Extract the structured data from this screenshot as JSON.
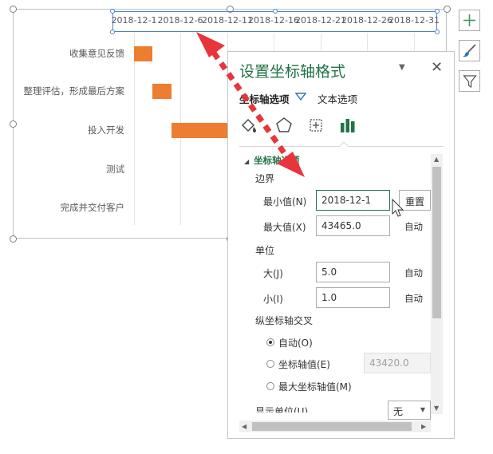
{
  "chart": {
    "date_ticks": [
      "2018-12-1",
      "2018-12-6",
      "2018-12-11",
      "2018-12-16",
      "2018-12-21",
      "2018-12-26",
      "2018-12-31"
    ],
    "tasks": [
      "收集意见反馈",
      "整理评估，形成最后方案",
      "投入开发",
      "测试",
      "完成并交付客户"
    ],
    "bar_color": "#ed7d31"
  },
  "tools": {
    "add_element_icon": "plus-icon",
    "style_icon": "brush-icon",
    "filter_icon": "funnel-icon"
  },
  "pane": {
    "title": "设置坐标轴格式",
    "tab_axis_options": "坐标轴选项",
    "tab_text_options": "文本选项",
    "section_axis_options": "坐标轴选项",
    "bounds": {
      "label": "边界",
      "min_label": "最小值(N)",
      "min_value": "2018-12-1",
      "reset_button": "重置",
      "max_label": "最大值(X)",
      "max_value": "43465.0",
      "max_auto": "自动"
    },
    "units": {
      "label": "单位",
      "major_label": "大(J)",
      "major_value": "5.0",
      "major_auto": "自动",
      "minor_label": "小(I)",
      "minor_value": "1.0",
      "minor_auto": "自动"
    },
    "crosses": {
      "label": "纵坐标轴交叉",
      "auto_label": "自动(O)",
      "value_label": "坐标轴值(E)",
      "value_value": "43420.0",
      "max_label": "最大坐标轴值(M)",
      "selected": "auto"
    },
    "display_units": {
      "label": "显示单位(U)",
      "value": "无"
    }
  },
  "accent_color": "#217346"
}
